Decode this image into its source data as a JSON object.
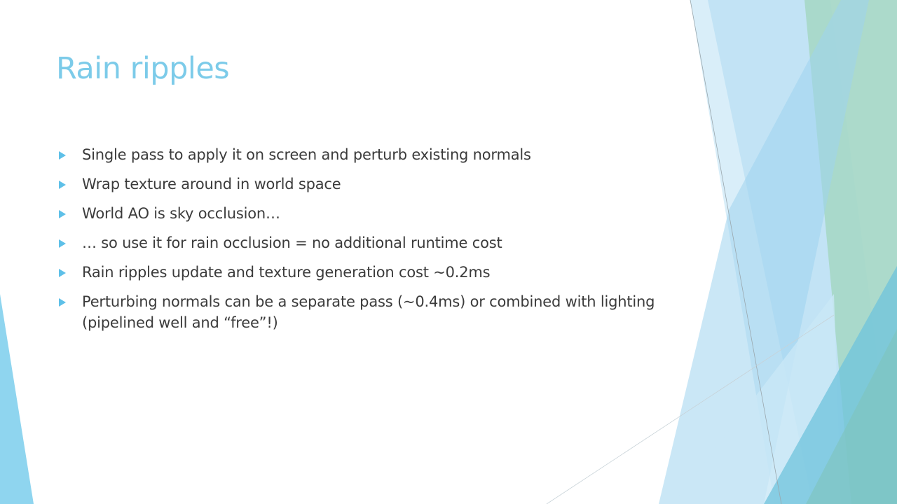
{
  "slide": {
    "title": "Rain ripples",
    "bullets": [
      "Single pass to apply it on screen and perturb existing normals",
      "Wrap texture around in world space",
      "World AO is sky occlusion…",
      "… so use it for rain occlusion = no additional runtime cost",
      "Rain ripples update and texture generation cost ~0.2ms",
      "Perturbing normals can be a separate pass (~0.4ms) or combined with lighting (pipelined well and “free”!)"
    ]
  },
  "colors": {
    "title": "#7ccbe9",
    "bullet_marker": "#5ec0e8",
    "body_text": "#3b3b3b",
    "deco_light_blue": "#bfe1f4",
    "deco_mid_blue": "#8fcdee",
    "deco_teal": "#7fc4c0",
    "deco_green": "#a8d8c8"
  }
}
